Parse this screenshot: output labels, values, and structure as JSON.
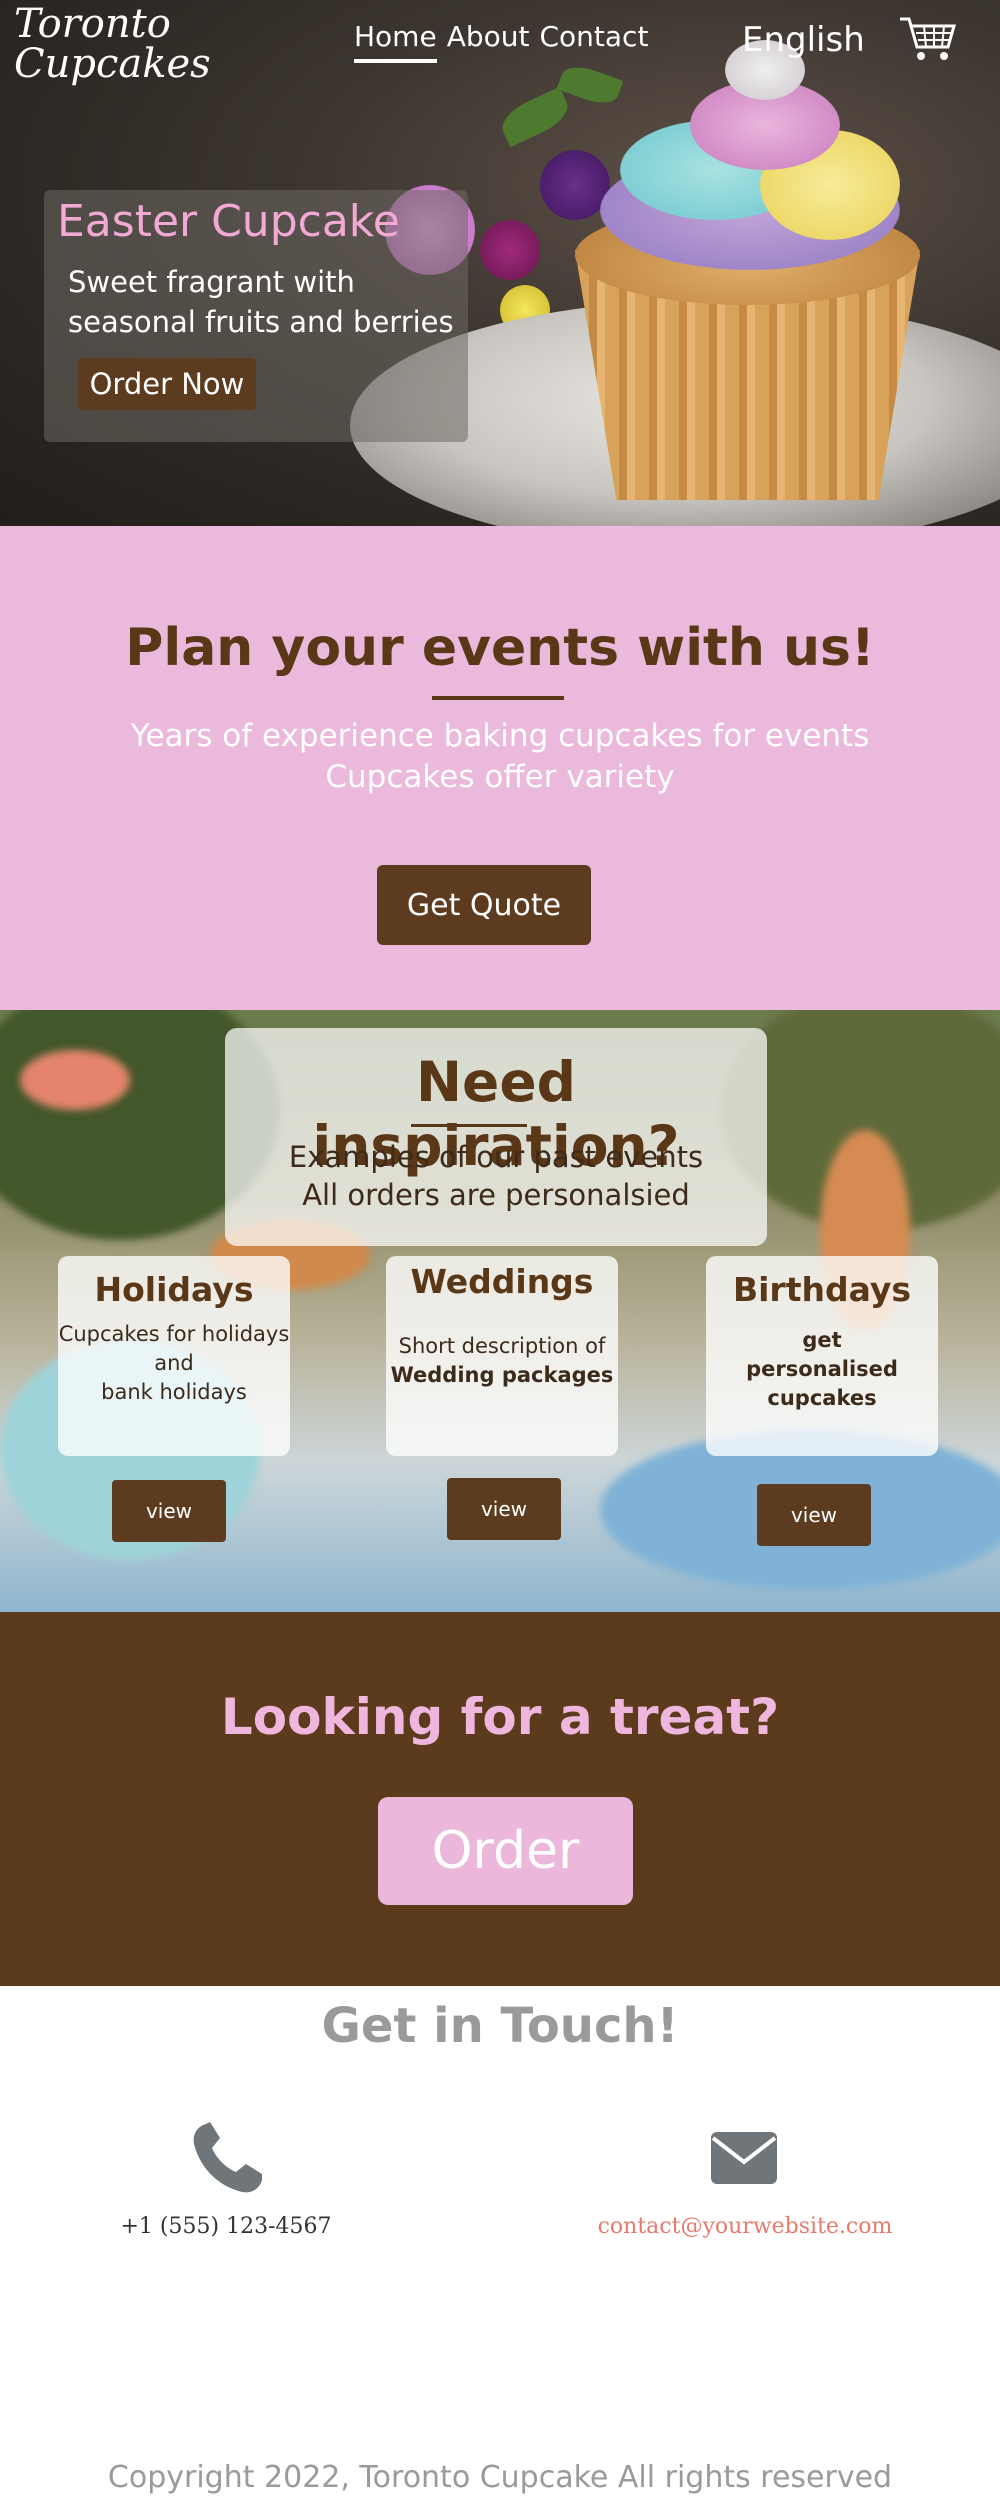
{
  "nav": {
    "brand": "Toronto Cupcakes",
    "links": [
      {
        "label": "Home",
        "active": true
      },
      {
        "label": "About",
        "active": false
      },
      {
        "label": "Contact",
        "active": false
      }
    ],
    "language": "English",
    "cart_icon": "cart-icon"
  },
  "hero": {
    "title": "Easter Cupcake",
    "subtitle": "Sweet fragrant with seasonal fruits and berries",
    "button": "Order Now"
  },
  "events": {
    "title": "Plan your events with us!",
    "lines": [
      "Years of experience baking cupcakes for events",
      "Cupcakes offer variety"
    ],
    "button": "Get Quote"
  },
  "inspiration": {
    "title": "Need inspiration?",
    "lines": [
      "Examples of our past events",
      "All orders are personalsied"
    ],
    "categories": [
      {
        "title": "Holidays",
        "desc": [
          "Cupcakes for holidays",
          "and",
          "bank holidays"
        ],
        "button": "view"
      },
      {
        "title": "Weddings",
        "desc": [
          "Short description of",
          "Wedding packages"
        ],
        "button": "view"
      },
      {
        "title": "Birthdays",
        "desc": [
          "get",
          "personalised",
          "cupcakes"
        ],
        "button": "view"
      }
    ]
  },
  "treat": {
    "title": "Looking for a treat?",
    "button": "Order"
  },
  "contact": {
    "title": "Get in Touch!",
    "phone_icon": "phone-icon",
    "phone": "+1 (555) 123-4567",
    "mail_icon": "mail-icon",
    "email": "contact@yourwebsite.com"
  },
  "footer": {
    "copyright": "Copyright 2022, Toronto Cupcake All rights reserved"
  },
  "colors": {
    "brown": "#5c3b1e",
    "pink": "#ebb9dc",
    "title_pink": "#f2a9d4",
    "link_coral": "#e77a6b"
  }
}
